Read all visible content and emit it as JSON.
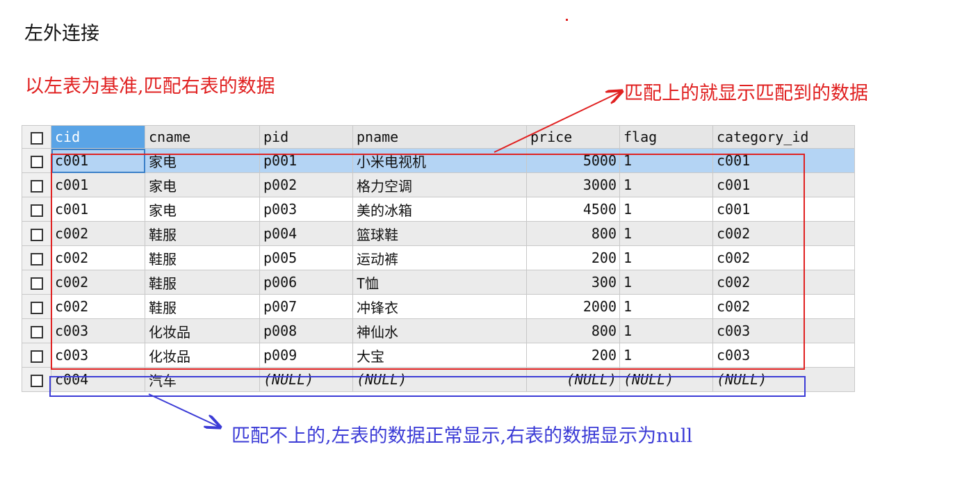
{
  "heading": "左外连接",
  "notes": {
    "left_join_rule": "以左表为基准,匹配右表的数据",
    "matched": "匹配上的就显示匹配到的数据",
    "unmatched": "匹配不上的,左表的数据正常显示,右表的数据显示为null"
  },
  "colors": {
    "annotation_red": "#e02020",
    "annotation_blue": "#3b3bd6",
    "selected_row": "#b4d4f4",
    "active_header": "#5aa4e6"
  },
  "table": {
    "columns": [
      "cid",
      "cname",
      "pid",
      "pname",
      "price",
      "flag",
      "category_id"
    ],
    "active_column": "cid",
    "selected_row_index": 0,
    "rows": [
      [
        "c001",
        "家电",
        "p001",
        "小米电视机",
        "5000",
        "1",
        "c001"
      ],
      [
        "c001",
        "家电",
        "p002",
        "格力空调",
        "3000",
        "1",
        "c001"
      ],
      [
        "c001",
        "家电",
        "p003",
        "美的冰箱",
        "4500",
        "1",
        "c001"
      ],
      [
        "c002",
        "鞋服",
        "p004",
        "篮球鞋",
        "800",
        "1",
        "c002"
      ],
      [
        "c002",
        "鞋服",
        "p005",
        "运动裤",
        "200",
        "1",
        "c002"
      ],
      [
        "c002",
        "鞋服",
        "p006",
        "T恤",
        "300",
        "1",
        "c002"
      ],
      [
        "c002",
        "鞋服",
        "p007",
        "冲锋衣",
        "2000",
        "1",
        "c002"
      ],
      [
        "c003",
        "化妆品",
        "p008",
        "神仙水",
        "800",
        "1",
        "c003"
      ],
      [
        "c003",
        "化妆品",
        "p009",
        "大宝",
        "200",
        "1",
        "c003"
      ],
      [
        "c004",
        "汽车",
        "(NULL)",
        "(NULL)",
        "(NULL)",
        "(NULL)",
        "(NULL)"
      ]
    ]
  }
}
